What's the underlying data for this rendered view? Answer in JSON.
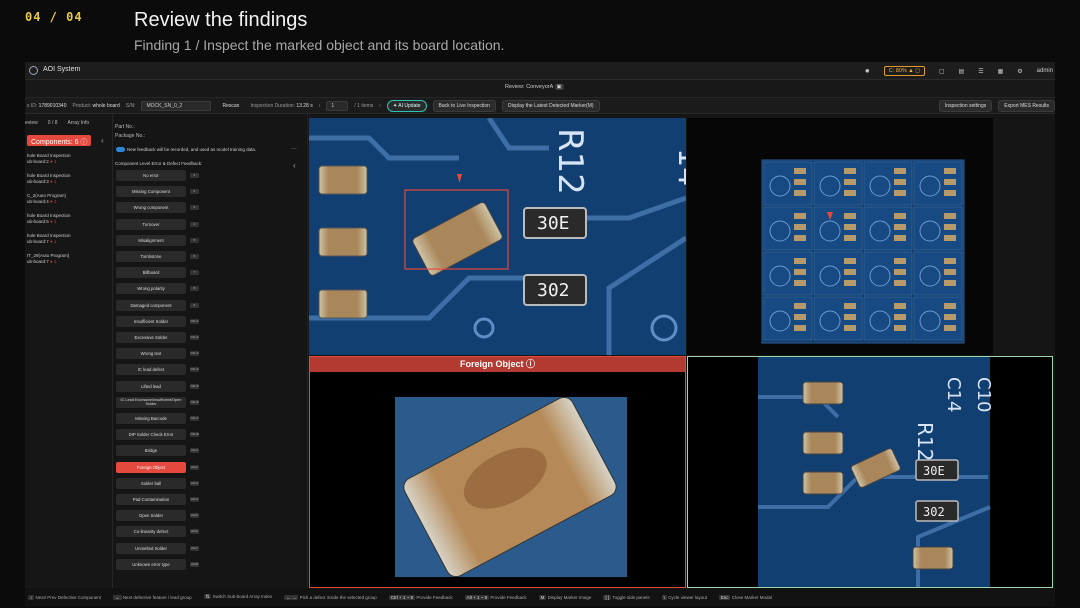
{
  "slide": {
    "number": "04 / 04",
    "title": "Review the findings",
    "subtitle": "Finding 1  /  Inspect the marked object and its board location."
  },
  "app": {
    "title": "AOI System",
    "status": "C: 80%",
    "user": "admin",
    "review_tab": "Review: ConveyorA"
  },
  "infobar": {
    "id_label": "s ID:",
    "id": "1789010340",
    "product_label": "Product:",
    "product": "whole board",
    "sn_label": "S/N:",
    "sn": "MOCK_SN_0_2",
    "rescan": "Rescan",
    "duration_label": "Inspection Duration:",
    "duration": "13.28 s",
    "page": "1",
    "items": "/ 1 items"
  },
  "buttons": {
    "ai_update": "AI Update",
    "back_live": "Back to Live Inspection",
    "display_latest": "Display the Latest Detected Marker(M)",
    "inspection_settings": "Inspection settings",
    "export_mes": "Export MES Results"
  },
  "left": {
    "tab1": "eview",
    "tab2": "0 / 8",
    "tab3": "Array Info",
    "components": "Components: 6",
    "items": [
      {
        "name": "hole Board Inspection",
        "board": "ub-board:2",
        "count": "1"
      },
      {
        "name": "hole Board Inspection",
        "board": "ub-board:3",
        "count": "1"
      },
      {
        "name": "C_2(Auto Program)",
        "board": "ub-board:4",
        "count": "2"
      },
      {
        "name": "hole Board Inspection",
        "board": "ub-board:5",
        "count": "1"
      },
      {
        "name": "hole Board Inspection",
        "board": "ub-board:7",
        "count": "1"
      },
      {
        "name": "IT_29(Auto Program)",
        "board": "ub-board:7",
        "count": "1"
      }
    ]
  },
  "mid": {
    "part_no": "Part No.:",
    "package_no": "Package No.:",
    "feedback_note": "New feedback will be recorded, and used as model training data.",
    "section": "Component Level Error & Defect Feedback:",
    "defects": [
      {
        "label": "No error",
        "key": "1"
      },
      {
        "label": "Missing Component",
        "key": "2"
      },
      {
        "label": "Wrong component",
        "key": "3"
      },
      {
        "label": "Turnover",
        "key": "4"
      },
      {
        "label": "Misalignment",
        "key": "5"
      },
      {
        "label": "Tombstone",
        "key": "6"
      },
      {
        "label": "Billboard",
        "key": "7"
      },
      {
        "label": "Wrong polarity",
        "key": "8"
      },
      {
        "label": "Damaged component",
        "key": "9"
      },
      {
        "label": "Insufficient Solder",
        "key": "Ctrl+1"
      },
      {
        "label": "Excessive Solder",
        "key": "Ctrl+2"
      },
      {
        "label": "Wrong text",
        "key": "Ctrl+3"
      },
      {
        "label": "IC lead defect",
        "key": "Ctrl+4"
      },
      {
        "label": "Lifted lead",
        "key": "Ctrl+5"
      },
      {
        "label": "IC Lead Excessive/Insufficient/Open Solder",
        "key": "Ctrl+6"
      },
      {
        "label": "Missing Barcode",
        "key": "Ctrl+7"
      },
      {
        "label": "DIP Solder Check Error",
        "key": "Ctrl+8"
      },
      {
        "label": "Bridge",
        "key": "Alt+1"
      },
      {
        "label": "Foreign Object",
        "key": "Alt+2",
        "active": true
      },
      {
        "label": "Solder ball",
        "key": "Alt+3"
      },
      {
        "label": "Pad Contamination",
        "key": "Alt+4"
      },
      {
        "label": "Open Solder",
        "key": "Alt+5"
      },
      {
        "label": "Co-linearity defect",
        "key": "Alt+6"
      },
      {
        "label": "Unmelted Solder",
        "key": "Alt+7"
      },
      {
        "label": "Unknown error type",
        "key": "Alt+8"
      }
    ]
  },
  "viewer": {
    "defect_title": "Foreign Object",
    "chip_labels": [
      "30E",
      "302"
    ],
    "silk": [
      "R12",
      "14",
      "C10",
      "C14"
    ]
  },
  "footer": [
    {
      "key": "↕",
      "text": "Next/ Prev Defective Component"
    },
    {
      "key": "↔",
      "text": "Next defective feature / lead group"
    },
    {
      "key": "⇅",
      "text": "Switch Sub-board Array Index"
    },
    {
      "key": "← →",
      "text": "Pick a defect inside the selected group"
    },
    {
      "key": "Ctrl + 1 ~ 9",
      "text": "Provide Feedback"
    },
    {
      "key": "Alt + 1 ~ 9",
      "text": "Provide Feedback"
    },
    {
      "key": "M",
      "text": "Display Marker Image"
    },
    {
      "key": "[ ]",
      "text": "Toggle side panels"
    },
    {
      "key": "\\",
      "text": "Cycle viewer layout"
    },
    {
      "key": "Esc",
      "text": "Close Marker Modal"
    }
  ]
}
